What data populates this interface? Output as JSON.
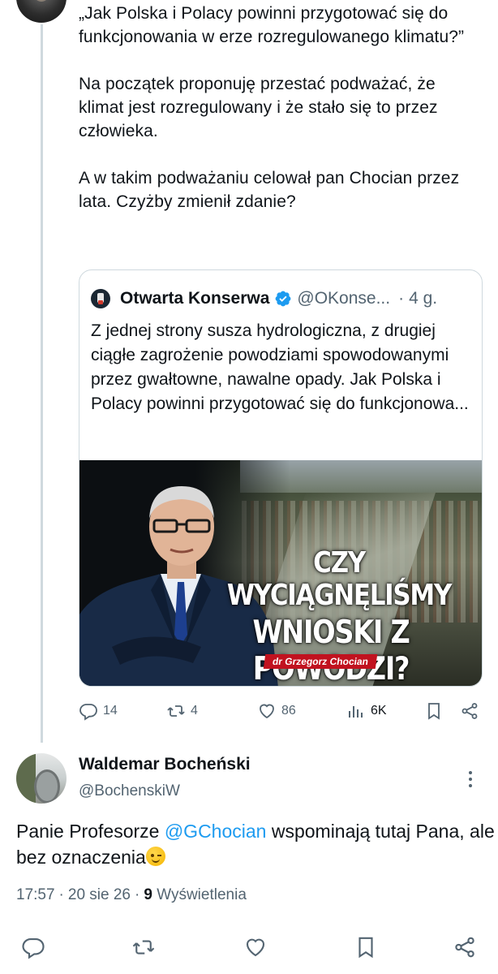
{
  "parent_tweet": {
    "paragraphs": [
      "„Jak Polska i Polacy powinni przygotować się do funkcjonowania w erze rozregulowanego klimatu?”",
      "Na początek proponuję przestać podważać, że klimat jest rozregulowany i że stało się to przez człowieka.",
      "A w takim podważaniu celował pan Chocian przez lata. Czyżby zmienił zdanie?"
    ]
  },
  "quote": {
    "name": "Otwarta Konserwa",
    "handle": "@OKonse...",
    "separator": "·",
    "time": "4 g.",
    "text": "Z jednej strony susza hydrologiczna, z drugiej ciągłe zagrożenie powodziami spowodowanymi przez gwałtowne, nawalne opady. Jak Polska i Polacy powinni przygotować się do funkcjonowa...",
    "image": {
      "title_line1": "CZY",
      "title_line2": "WYCIĄGNĘLIŚMY",
      "title_line3": "WNIOSKI Z POWODZI?",
      "author": "dr Grzegorz Chocian"
    }
  },
  "parent_actions": {
    "replies": "14",
    "reposts": "4",
    "likes": "86",
    "views": "6K"
  },
  "reply": {
    "name": "Waldemar Bocheński",
    "handle": "@BochenskiW",
    "text_before": "Panie Profesorze ",
    "mention": "@GChocian",
    "text_after": " wspominają tutaj Pana, ale bez oznaczenia",
    "time": "17:57",
    "date": "20 sie 26",
    "separator": "·",
    "views_count": "9",
    "views_label": "Wyświetlenia"
  },
  "colors": {
    "text": "#0f1419",
    "secondary": "#536471",
    "link": "#1d9bf0",
    "border": "#cfd9de",
    "verified": "#1d9bf0",
    "banner_red": "#c1121f"
  }
}
